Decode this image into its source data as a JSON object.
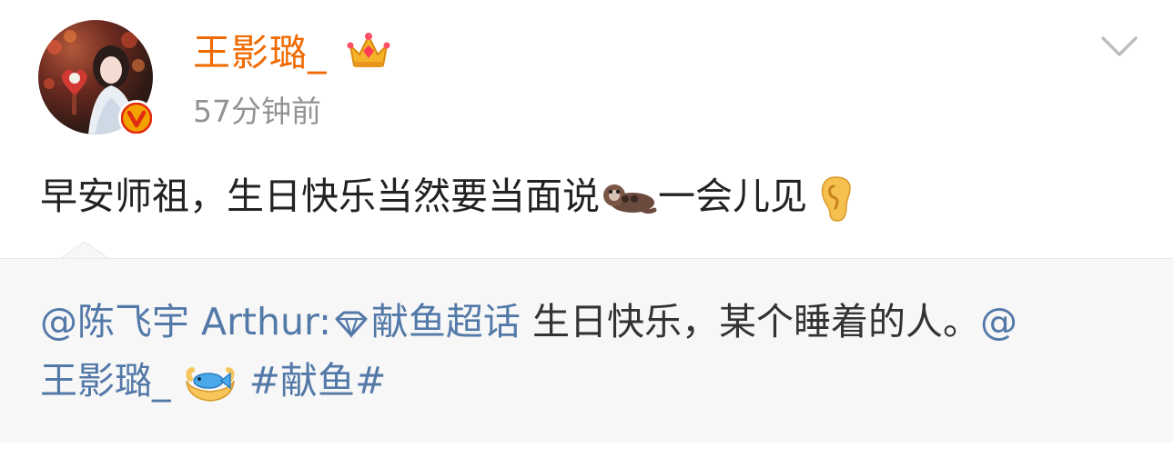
{
  "post": {
    "author_name": "王影璐_",
    "author_badge_icon": "crown-icon",
    "verified_icon": "verified-v-icon",
    "timestamp": "57分钟前",
    "text_before_emoji": "早安师祖，生日快乐当然要当面说",
    "text_after_emoji": "一会儿见",
    "emoji_1": "otter-emoji",
    "emoji_2": "ear-emoji"
  },
  "repost": {
    "mention_author": "@陈飞宇 Arthur:",
    "topic_icon": "diamond-topic-icon",
    "topic_label": "献鱼超话",
    "body_text": " 生日快乐，某个睡着的人。",
    "mention_2_part1": "@",
    "mention_2_part2": "王影璐_",
    "emoji": "hands-fish-emoji",
    "hashtag": "#献鱼#"
  },
  "colors": {
    "username": "#f16a00",
    "timestamp": "#939393",
    "link": "#5379a8",
    "repost_bg": "#f7f7f7"
  }
}
